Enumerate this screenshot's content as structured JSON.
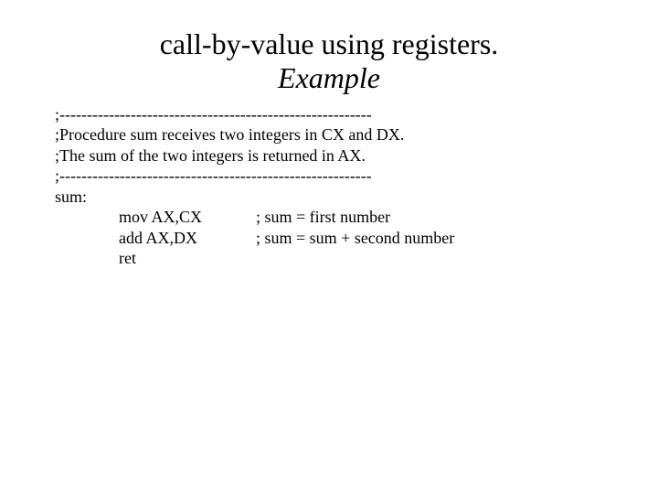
{
  "title": {
    "line1": "call-by-value using registers.",
    "line2": "Example"
  },
  "lines": {
    "sep1": ";---------------------------------------------------------",
    "desc1": ";Procedure sum receives two integers in CX and DX.",
    "desc2": ";The sum of the two integers is returned in AX.",
    "sep2": ";---------------------------------------------------------",
    "label": "sum:",
    "instr1": "mov AX,CX",
    "comment1": "; sum = first number",
    "instr2": "add AX,DX",
    "comment2": "; sum = sum + second number",
    "instr3": "ret"
  }
}
